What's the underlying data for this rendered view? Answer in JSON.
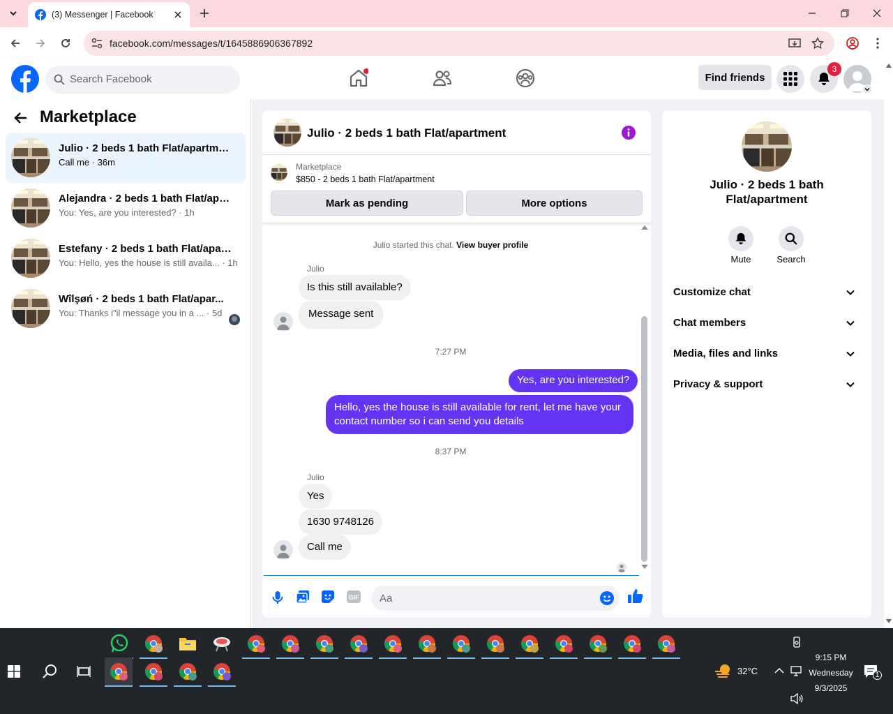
{
  "browser": {
    "tab_title": "(3) Messenger | Facebook",
    "url": "facebook.com/messages/t/1645886906367892"
  },
  "header": {
    "search_placeholder": "Search Facebook",
    "find_friends": "Find friends",
    "notification_count": "3"
  },
  "sidebar": {
    "title": "Marketplace",
    "conversations": [
      {
        "name": "Julio · 2 beds 1 bath Flat/apartment",
        "snippet": "Call me · 36m"
      },
      {
        "name": "Alejandra · 2 beds 1 bath Flat/apar...",
        "snippet": "You: Yes, are you interested? · 1h"
      },
      {
        "name": "Estefany · 2 beds 1 bath Flat/apart...",
        "snippet": "You: Hello, yes the house is still availa... · 1h"
      },
      {
        "name": "Wîlşøń · 2 beds 1 bath Flat/apar...",
        "snippet": "You: Thanks i\"il message you in a ... · 5d"
      }
    ]
  },
  "chat": {
    "title": "Julio · 2 beds 1 bath Flat/apartment",
    "listing_source": "Marketplace",
    "listing_price": "$850 - 2 beds 1 bath Flat/apartment",
    "mark_pending": "Mark as pending",
    "more_options": "More options",
    "started_note": "Julio started this chat.",
    "view_profile": "View buyer profile",
    "sender1": "Julio",
    "msg1": "Is this still available?",
    "msg2": "Message sent",
    "time1": "7:27 PM",
    "out1": "Yes, are you interested?",
    "out2": "Hello, yes the house is still available for rent, let me have your contact number so i can send you details",
    "time2": "8:37 PM",
    "sender2": "Julio",
    "msg3": "Yes",
    "msg4": "1630 9748126",
    "msg5": "Call me",
    "composer_placeholder": "Aa"
  },
  "info_panel": {
    "title": "Julio · 2 beds 1 bath Flat/apartment",
    "mute": "Mute",
    "search": "Search",
    "sections": [
      "Customize chat",
      "Chat members",
      "Media, files and links",
      "Privacy & support"
    ]
  },
  "taskbar": {
    "temperature": "32°C",
    "time": "9:15 PM",
    "day": "Wednesday",
    "date": "9/3/2025",
    "action_center_count": "1"
  },
  "colors": {
    "fb_blue": "#0866ff",
    "outgoing_bubble": "#6334f4",
    "info_icon": "#9b19d2",
    "badge_red": "#e41e3f"
  }
}
